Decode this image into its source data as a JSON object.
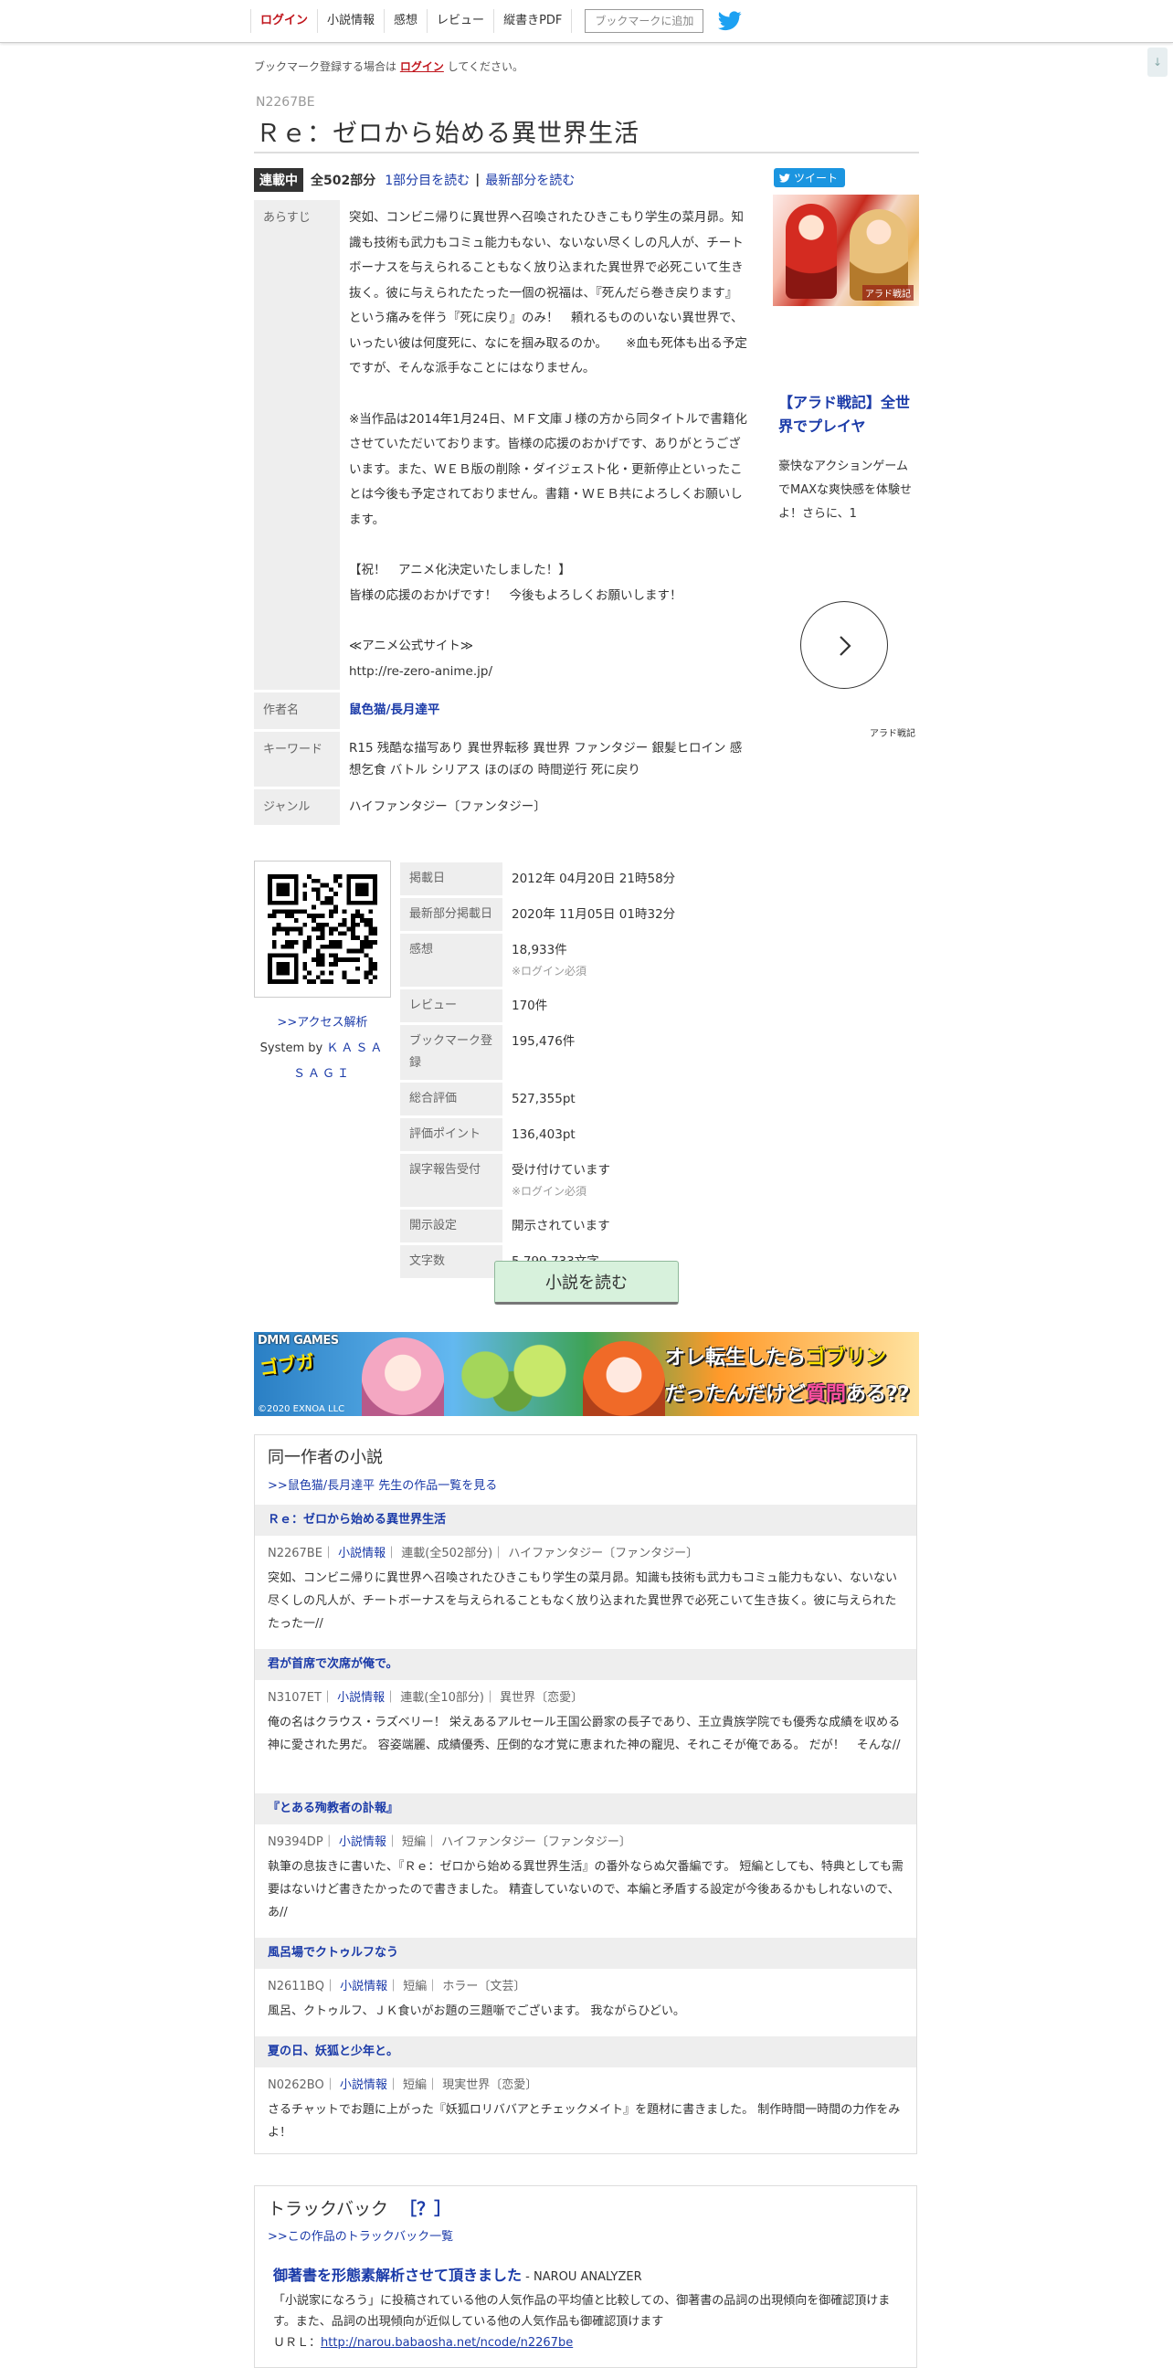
{
  "nav": {
    "items": [
      "ログイン",
      "小説情報",
      "感想",
      "レビュー",
      "縦書きPDF"
    ],
    "bookmark_button": "ブックマークに追加",
    "scroll_top": "↓"
  },
  "login_note": {
    "before": "ブックマーク登録する場合は",
    "link": "ログイン",
    "after": "してください。"
  },
  "novel": {
    "ncode": "N2267BE",
    "title": "Ｒｅ：ゼロから始める異世界生活",
    "status": "連載中",
    "total": "全502部分",
    "read_first": "1部分目を読む",
    "separator": "|",
    "read_latest": "最新部分を読む"
  },
  "info": {
    "synopsis_label": "あらすじ",
    "synopsis_paragraphs": [
      "突如、コンビニ帰りに異世界へ召喚されたひきこもり学生の菜月昴。知識も技術も武力もコミュ能力もない、ないない尽くしの凡人が、チートボーナスを与えられることもなく放り込まれた異世界で必死こいて生き抜く。彼に与えられたたった一個の祝福は、『死んだら巻き戻ります』という痛みを伴う『死に戻り』のみ！　頼れるもののいない異世界で、いったい彼は何度死に、なにを掴み取るのか。　　※血も死体も出る予定ですが、そんな派手なことにはなりません。",
      "※当作品は2014年1月24日、ＭＦ文庫Ｊ様の方から同タイトルで書籍化させていただいております。皆様の応援のおかげです、ありがとうございます。また、ＷＥＢ版の削除・ダイジェスト化・更新停止といったことは今後も予定されておりません。書籍・ＷＥＢ共によろしくお願いします。",
      "【祝！　アニメ化決定いたしました！】\n皆様の応援のおかげです！　今後もよろしくお願いします！",
      "≪アニメ公式サイト≫\nhttp://re-zero-anime.jp/"
    ],
    "author_label": "作者名",
    "author": "鼠色猫/長月達平",
    "keyword_label": "キーワード",
    "keywords": "R15 残酷な描写あり 異世界転移  異世界 ファンタジー 銀髪ヒロイン 感想乞食 バトル シリアス ほのぼの 時間逆行 死に戻り",
    "genre_label": "ジャンル",
    "genre": "ハイファンタジー〔ファンタジー〕"
  },
  "ad": {
    "tweet": "ツイート",
    "image_logo": "アラド戦記",
    "headline": "【アラド戦記】全世界でプレイヤ",
    "body": "豪快なアクションゲームでMAXな爽快感を体験せよ！さらに、1",
    "sponsor": "アラド戦記"
  },
  "side": {
    "access_link": ">>アクセス解析",
    "system_by": "System by",
    "system_link": "ＫＡＳＡＳＡＧＩ"
  },
  "stats": [
    {
      "label": "掲載日",
      "value": "2012年 04月20日 21時58分",
      "note": ""
    },
    {
      "label": "最新部分掲載日",
      "value": "2020年 11月05日 01時32分",
      "note": ""
    },
    {
      "label": "感想",
      "value": "18,933件",
      "note": "※ログイン必須"
    },
    {
      "label": "レビュー",
      "value": "170件",
      "note": ""
    },
    {
      "label": "ブックマーク登録",
      "value": "195,476件",
      "note": ""
    },
    {
      "label": "総合評価",
      "value": "527,355pt",
      "note": ""
    },
    {
      "label": "評価ポイント",
      "value": "136,403pt",
      "note": ""
    },
    {
      "label": "誤字報告受付",
      "value": "受け付けています",
      "note": "※ログイン必須"
    },
    {
      "label": "開示設定",
      "value": "開示されています",
      "note": ""
    },
    {
      "label": "文字数",
      "value": "5,799,733文字",
      "note": ""
    }
  ],
  "read_button": "小説を読む",
  "banner": {
    "brand": "DMM GAMES",
    "sub": "ゴブガ",
    "copyright": "©2020 EXNOA LLC",
    "line1a": "オレ転生したら",
    "line1b": "ゴブリン",
    "line2a": "だったんだけど",
    "line2b": "質問",
    "line2c": "ある??"
  },
  "same_author": {
    "title": "同一作者の小説",
    "link": ">>鼠色猫/長月達平 先生の作品一覧を見る",
    "info_link": "小説情報",
    "novels": [
      {
        "title": "Ｒｅ：ゼロから始める異世界生活",
        "ncode": "N2267BE",
        "type": "連載(全502部分)",
        "genre": "ハイファンタジー〔ファンタジー〕",
        "excerpt": "突如、コンビニ帰りに異世界へ召喚されたひきこもり学生の菜月昴。知識も技術も武力もコミュ能力もない、ないない尽くしの凡人が、チートボーナスを与えられることもなく放り込まれた異世界で必死こいて生き抜く。彼に与えられたたった一//"
      },
      {
        "title": "君が首席で次席が俺で。",
        "ncode": "N3107ET",
        "type": "連載(全10部分)",
        "genre": "異世界〔恋愛〕",
        "excerpt": "俺の名はクラウス・ラズベリー！ 栄えあるアルセール王国公爵家の長子であり、王立貴族学院でも優秀な成績を収める神に愛された男だ。 容姿端麗、成績優秀、圧倒的な才覚に恵まれた神の寵児、それこそが俺である。 だが！　そんな//"
      },
      {
        "title": "『とある殉教者の訃報』",
        "ncode": "N9394DP",
        "type": "短編",
        "genre": "ハイファンタジー〔ファンタジー〕",
        "excerpt": "執筆の息抜きに書いた、『Ｒｅ：ゼロから始める異世界生活』の番外ならぬ欠番編です。 短編としても、特典としても需要はないけど書きたかったので書きました。 精査していないので、本編と矛盾する設定が今後あるかもしれないので、あ//"
      },
      {
        "title": "風呂場でクトゥルフなう",
        "ncode": "N2611BQ",
        "type": "短編",
        "genre": "ホラー〔文芸〕",
        "excerpt": "風呂、クトゥルフ、ＪＫ食いがお題の三題噺でございます。 我ながらひどい。"
      },
      {
        "title": "夏の日、妖狐と少年と。",
        "ncode": "N0262BO",
        "type": "短編",
        "genre": "現実世界〔恋愛〕",
        "excerpt": "さるチャットでお題に上がった『妖狐ロリババアとチェックメイト』を題材に書きました。 制作時間一時間の力作をみよ！"
      }
    ]
  },
  "trackback": {
    "title": "トラックバック",
    "help": "［？］",
    "link": ">>この作品のトラックバック一覧",
    "entry_title": "御著書を形態素解析させて頂きました",
    "entry_source": " - NAROU ANALYZER",
    "entry_text": "「小説家になろう」に投稿されている他の人気作品の平均値と比較しての、御著書の品詞の出現傾向を御確認頂けます。また、品詞の出現傾向が近似している他の人気作品も御確認頂けます",
    "url_label": "ＵＲＬ：",
    "url": "http://narou.babaosha.net/ncode/n2267be"
  }
}
